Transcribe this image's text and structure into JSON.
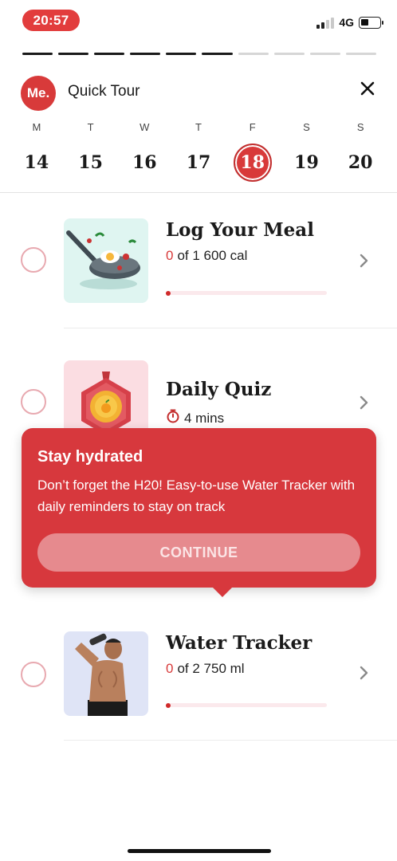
{
  "status_bar": {
    "time": "20:57",
    "network": "4G",
    "signal_bars": 2,
    "battery_level": 0.3
  },
  "progress": {
    "total_steps": 10,
    "completed_steps": 6
  },
  "header": {
    "logo": "Me.",
    "title": "Quick Tour",
    "close_icon": "close-icon"
  },
  "week": {
    "days": [
      {
        "name": "M",
        "date": "14"
      },
      {
        "name": "T",
        "date": "15"
      },
      {
        "name": "W",
        "date": "16"
      },
      {
        "name": "T",
        "date": "17"
      },
      {
        "name": "F",
        "date": "18",
        "selected": true
      },
      {
        "name": "S",
        "date": "19"
      },
      {
        "name": "S",
        "date": "20"
      }
    ]
  },
  "tasks": {
    "meal": {
      "title": "Log Your Meal",
      "current": "0",
      "rest": "of 1 600 cal",
      "progress": 0.0,
      "icon": "frying-pan-illustration"
    },
    "quiz": {
      "title": "Daily Quiz",
      "duration": "4 mins",
      "icon": "medal-illustration",
      "timer_icon": "stopwatch-icon"
    },
    "water": {
      "title": "Water Tracker",
      "current": "0",
      "rest": "of 2 750 ml",
      "progress": 0.0,
      "icon": "man-drinking-photo"
    }
  },
  "tooltip": {
    "title": "Stay hydrated",
    "body": "Don’t forget the H20! Easy-to-use Water Tracker with daily reminders to stay on track",
    "button": "CONTINUE"
  },
  "colors": {
    "accent": "#d83a3a",
    "tooltip": "#d7383d",
    "radio_border": "#e8a9b0"
  }
}
